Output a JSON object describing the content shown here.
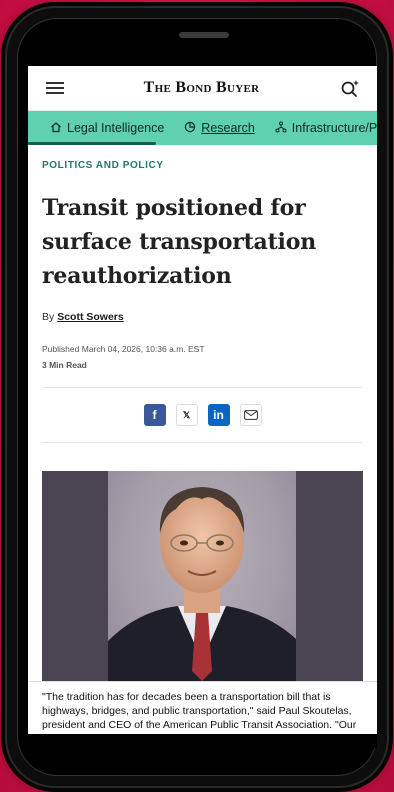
{
  "header": {
    "brand": "The Bond Buyer"
  },
  "nav": {
    "items": [
      {
        "label": "Legal Intelligence",
        "icon": "home-icon"
      },
      {
        "label": "Research",
        "icon": "chart-icon"
      },
      {
        "label": "Infrastructure/P",
        "icon": "network-icon"
      }
    ]
  },
  "article": {
    "kicker": "POLITICS AND POLICY",
    "headline": "Transit positioned for surface transportation reauthorization",
    "byline_prefix": "By",
    "author": "Scott Sowers",
    "published": "Published March 04, 2026, 10:36 a.m. EST",
    "read_time": "3 Min Read",
    "share": {
      "facebook": "f",
      "x": "𝕏",
      "linkedin": "in"
    },
    "caption": "\"The tradition has for decades been a transportation bill that is highways, bridges, and public transportation,\" said Paul Skoutelas, president and CEO of the American Public Transit Association. \"Our expectation is that's what it will be. All the"
  },
  "colors": {
    "accent": "#5fd0b0",
    "kicker": "#207a68",
    "background": "#e3134f"
  }
}
